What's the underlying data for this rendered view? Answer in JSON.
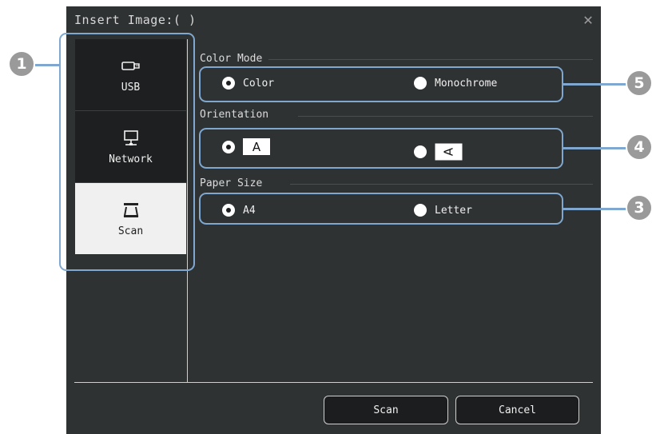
{
  "dialog": {
    "title": "Insert Image:(  )",
    "close_glyph": "✕"
  },
  "sidebar": {
    "items": [
      {
        "label": "USB",
        "icon": "usb-drive-icon",
        "selected": false
      },
      {
        "label": "Network",
        "icon": "network-computer-icon",
        "selected": false
      },
      {
        "label": "Scan",
        "icon": "scanner-icon",
        "selected": true
      }
    ]
  },
  "color_mode": {
    "label": "Color Mode",
    "options": [
      {
        "label": "Color",
        "selected": true
      },
      {
        "label": "Monochrome",
        "selected": false
      }
    ]
  },
  "orientation": {
    "label": "Orientation",
    "options": [
      {
        "glyph": "A",
        "icon": "portrait-orientation-icon",
        "selected": true
      },
      {
        "glyph": "A",
        "icon": "landscape-orientation-icon",
        "selected": false
      }
    ]
  },
  "paper_size": {
    "label": "Paper Size",
    "options": [
      {
        "label": "A4",
        "selected": true
      },
      {
        "label": "Letter",
        "selected": false
      }
    ]
  },
  "buttons": {
    "scan": "Scan",
    "cancel": "Cancel"
  },
  "callouts": [
    "1",
    "5",
    "4",
    "3"
  ],
  "colors": {
    "dialog_bg": "#2f3233",
    "highlight": "#7fa7cf",
    "callout": "#9a9a9a",
    "selected_tab": "#f0f0f0"
  }
}
